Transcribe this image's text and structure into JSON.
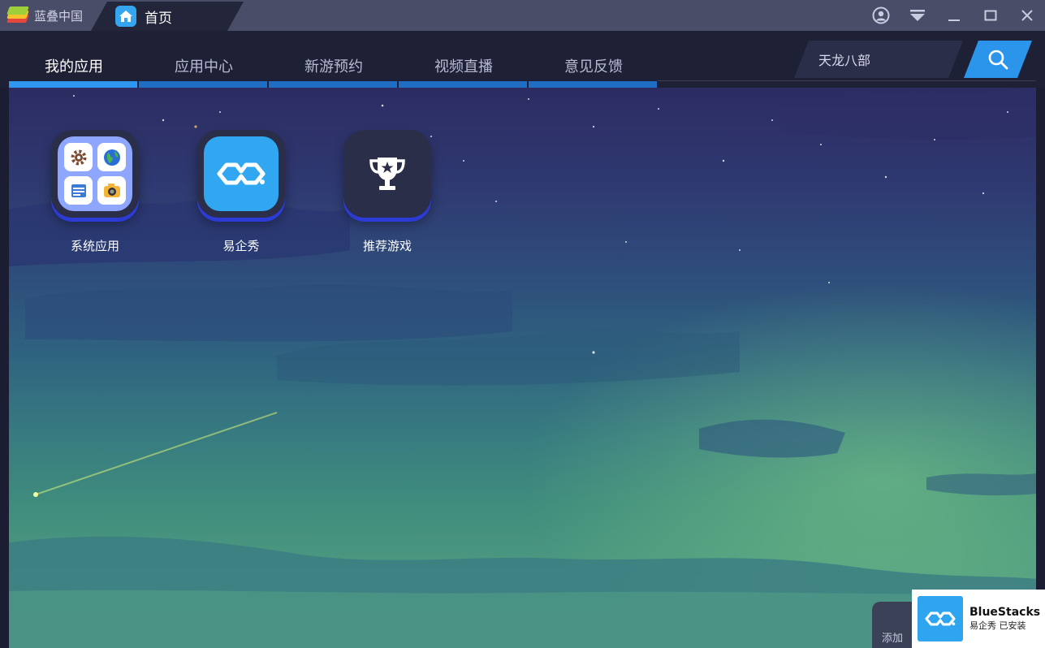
{
  "titlebar": {
    "brand_label": "蓝叠中国",
    "home_tab_label": "首页"
  },
  "window_controls": [
    "account-icon",
    "dropdown-icon",
    "minimize-icon",
    "maximize-icon",
    "close-icon"
  ],
  "nav": {
    "tabs": [
      {
        "label": "我的应用",
        "active": true
      },
      {
        "label": "应用中心",
        "active": false
      },
      {
        "label": "新游预约",
        "active": false
      },
      {
        "label": "视频直播",
        "active": false
      },
      {
        "label": "意见反馈",
        "active": false
      }
    ]
  },
  "search": {
    "value": "天龙八部"
  },
  "apps": [
    {
      "label": "系统应用",
      "icon": "system-apps-icon"
    },
    {
      "label": "易企秀",
      "icon": "eqxiu-icon"
    },
    {
      "label": "推荐游戏",
      "icon": "trophy-icon"
    }
  ],
  "add_button": {
    "label": "添加"
  },
  "toast": {
    "title": "BlueStacks",
    "subtitle": "易企秀 已安装"
  },
  "colors": {
    "accent_blue": "#2f96f0",
    "titlebar_bg": "#4a4d68",
    "nav_bg": "#1e2136",
    "search_button": "#2b95ec",
    "eqxiu_blue": "#2ea5ee"
  }
}
